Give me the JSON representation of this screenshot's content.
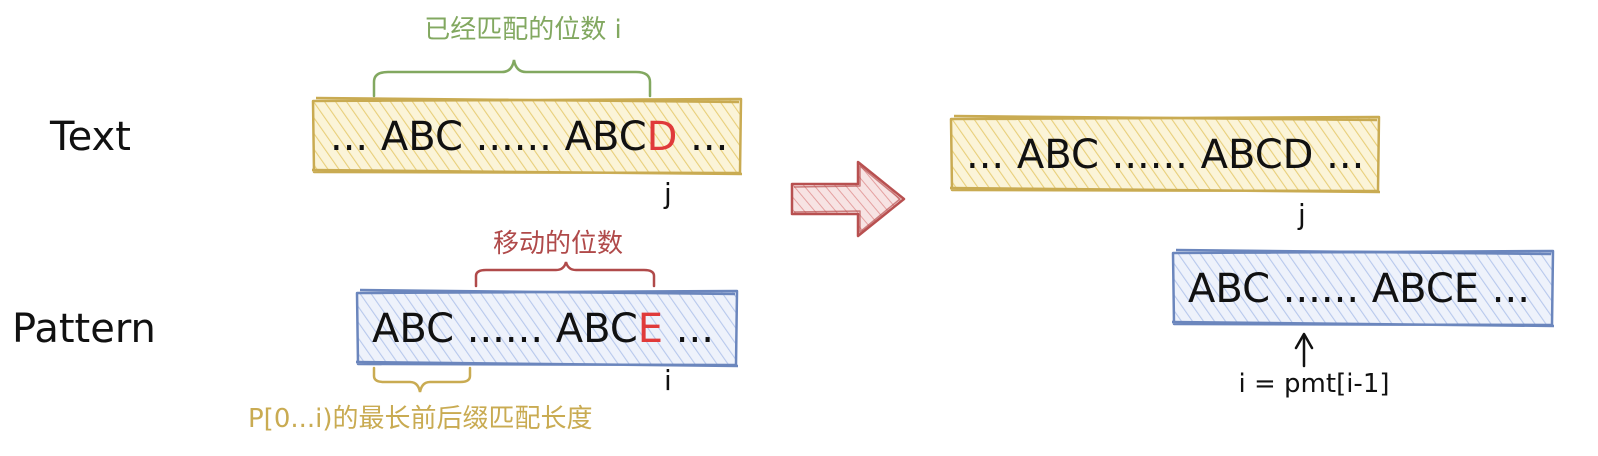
{
  "left": {
    "text_label": "Text",
    "pattern_label": "Pattern",
    "matched_count_label": "已经匹配的位数 i",
    "shift_count_label": "移动的位数",
    "prefix_label": "P[0...i)的最长前后缀匹配长度",
    "text_row": {
      "prefix": "... ABC ...... ABC",
      "highlight": "D",
      "suffix": " ..."
    },
    "pattern_row": {
      "prefix": "ABC ...... ABC",
      "highlight": "E",
      "suffix": " ..."
    },
    "j_marker": "j",
    "i_marker": "i"
  },
  "right": {
    "text_row": "... ABC ...... ABCD ...",
    "pattern_row": "ABC ...... ABCE ...",
    "j_marker": "j",
    "formula": "i = pmt[i-1]"
  },
  "colors": {
    "text_box_stroke": "#c9ab52",
    "text_box_fill": "#f5e6a8",
    "pattern_box_stroke": "#6b86bd",
    "pattern_box_fill": "#c6d4f0",
    "green": "#82a860",
    "red_label": "#b04a4a",
    "gold_label": "#c9ab52",
    "mismatch": "#e03a3a",
    "arrow": "#b85050",
    "ink": "#111111"
  },
  "icons": [
    "right-arrow-icon",
    "up-arrow-icon"
  ]
}
